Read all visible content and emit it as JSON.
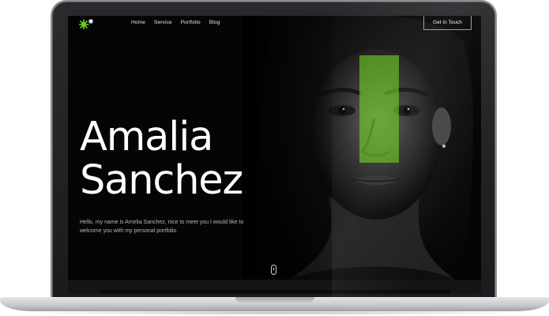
{
  "nav": {
    "logo_icon": "asterisk-logo-icon",
    "items": [
      "Home",
      "Service",
      "Portfolio",
      "Blog"
    ],
    "cta_label": "Get in Touch"
  },
  "hero": {
    "name_line1": "Amalia",
    "name_line2": "Sanchez",
    "intro_line1": "Hello, my name is Amelia Sanchez, nice to meet you I would like to",
    "intro_line2": "welcome you with my personal portfolio."
  },
  "colors": {
    "accent": "#6acd1c",
    "background": "#050505",
    "text": "#ffffff"
  },
  "scroll_icon": "mouse-scroll-icon"
}
